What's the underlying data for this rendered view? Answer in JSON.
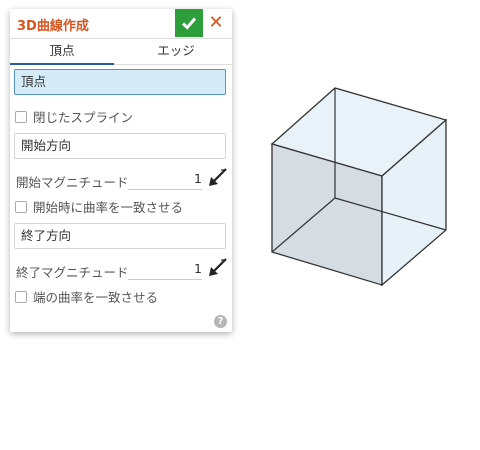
{
  "dialog": {
    "title": "3D曲線作成",
    "ok_icon": "check-icon",
    "cancel_icon": "close-icon",
    "cancel_glyph": "✕",
    "help_glyph": "?"
  },
  "tabs": [
    {
      "label": "頂点",
      "active": true
    },
    {
      "label": "エッジ",
      "active": false
    }
  ],
  "fields": {
    "vertices": "頂点",
    "closed_spline": "閉じたスプライン",
    "start_direction": "開始方向",
    "start_magnitude_label": "開始マグニチュード",
    "start_magnitude_value": "1",
    "match_curvature_start": "開始時に曲率を一致させる",
    "end_direction": "終了方向",
    "end_magnitude_label": "終了マグニチュード",
    "end_magnitude_value": "1",
    "match_curvature_end": "端の曲率を一致させる"
  },
  "colors": {
    "title": "#d9531e",
    "ok": "#2e9e3a",
    "selected_field": "#d5ecf8",
    "tab_underline": "#2a5f9e"
  }
}
